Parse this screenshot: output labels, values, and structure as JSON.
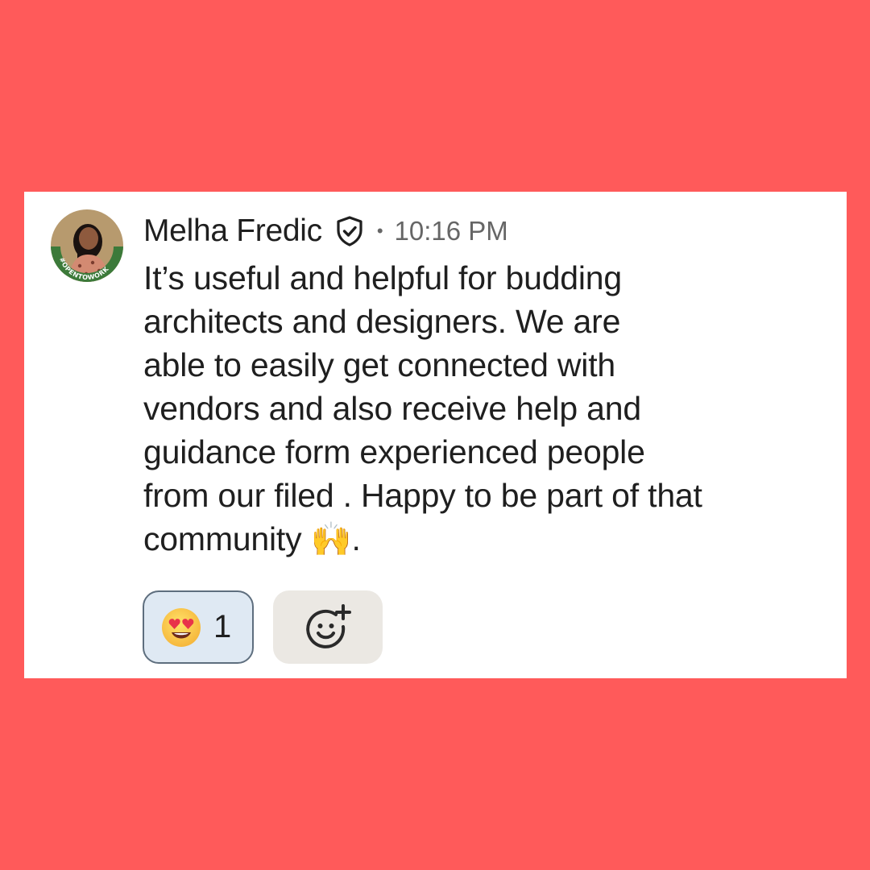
{
  "comment": {
    "author": "Melha Fredic",
    "avatar_badge": "#OPENTOWORK",
    "separator": "•",
    "time": "10:16 PM",
    "text": "It’s useful and helpful for budding\narchitects and designers. We are\nable to easily get connected with\nvendors and also receive help and\nguidance form experienced people\nfrom our filed . Happy to be part of that\ncommunity 🙌.",
    "verified_icon": "verified-shield-icon"
  },
  "reactions": [
    {
      "emoji": "smiling-face-with-heart-eyes",
      "count": "1"
    }
  ],
  "add_reaction_icon": "add-emoji-icon",
  "colors": {
    "background": "#FF5A5A",
    "card": "#FFFFFF",
    "reaction_pill_bg": "#DFE9F3",
    "reaction_pill_border": "#5E6E7E",
    "add_reaction_bg": "#EBE8E3",
    "open_to_work_ring": "#3C7A3A"
  }
}
